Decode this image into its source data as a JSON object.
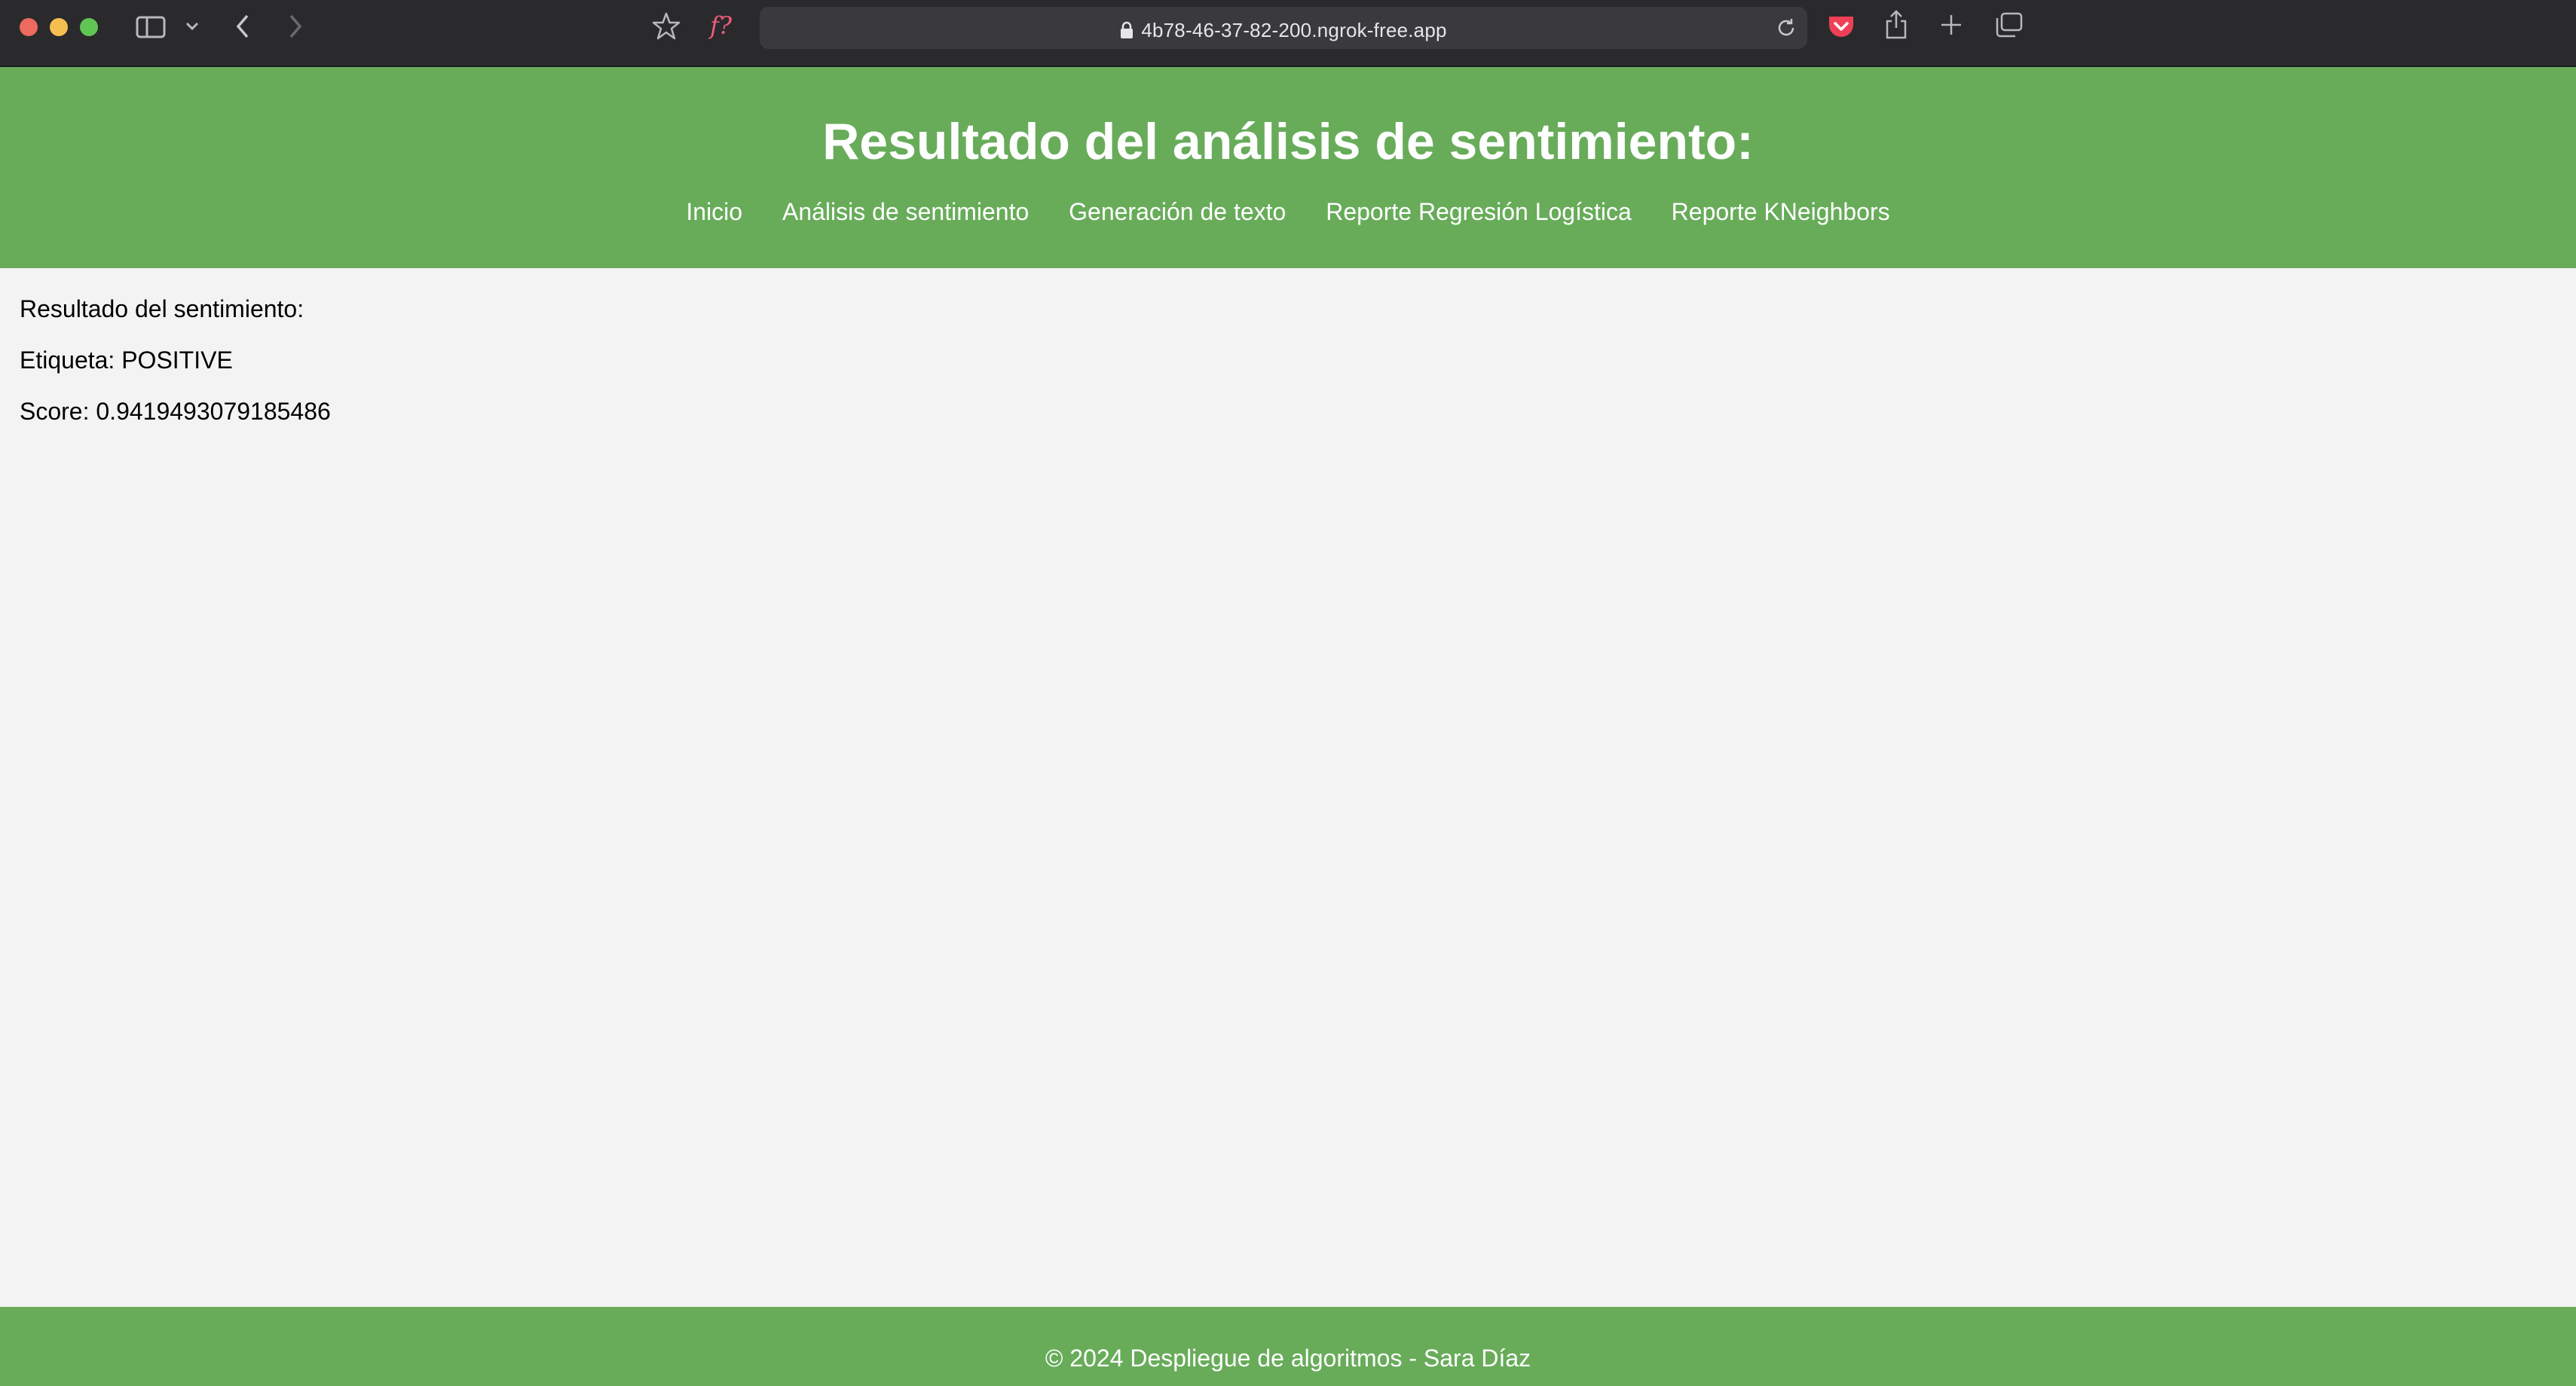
{
  "browser": {
    "url": "4b78-46-37-82-200.ngrok-free.app",
    "extension_label": "f?",
    "icons": [
      "sidebar-icon",
      "chevron-down-icon",
      "back-icon",
      "forward-icon",
      "star-icon",
      "lock-icon",
      "reload-icon",
      "pocket-icon",
      "share-icon",
      "plus-icon",
      "tabs-overview-icon"
    ],
    "colors": {
      "bar": "#2a2a2c",
      "url_bar": "#3a3a3c",
      "pocket": "#ef4056"
    }
  },
  "header": {
    "title": "Resultado del análisis de sentimiento:",
    "nav": [
      {
        "label": "Inicio"
      },
      {
        "label": "Análisis de sentimiento"
      },
      {
        "label": "Generación de texto"
      },
      {
        "label": "Reporte Regresión Logística"
      },
      {
        "label": "Reporte KNeighbors"
      }
    ]
  },
  "main": {
    "heading": "Resultado del sentimiento:",
    "label_line": "Etiqueta: POSITIVE",
    "score_line": "Score: 0.9419493079185486"
  },
  "footer": {
    "text": "© 2024 Despliegue de algoritmos - Sara Díaz"
  },
  "colors": {
    "accent_green": "#68ac5a",
    "page_background": "#f3f3f3"
  }
}
